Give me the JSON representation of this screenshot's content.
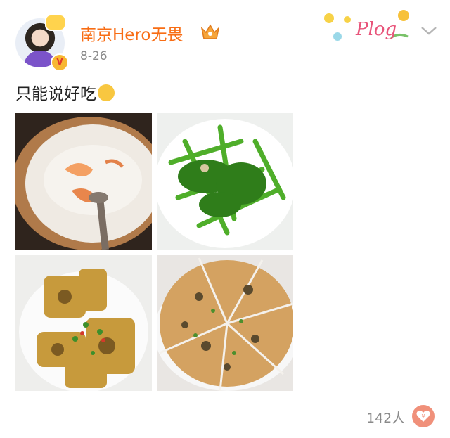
{
  "author": {
    "name": "南京Hero无畏",
    "date": "8-26",
    "verified_badge": "V"
  },
  "post": {
    "text": "只能说好吃"
  },
  "photos": [
    {
      "name": "congee-pot-photo"
    },
    {
      "name": "stir-fried-greens-photo"
    },
    {
      "name": "braised-fish-photo"
    },
    {
      "name": "egg-pancake-photo"
    }
  ],
  "sticker": {
    "text": "Plog"
  },
  "footer": {
    "likes": "142人"
  },
  "colors": {
    "name": "#f86d14",
    "meta": "#8a8a8a",
    "like": "#f0907a"
  }
}
